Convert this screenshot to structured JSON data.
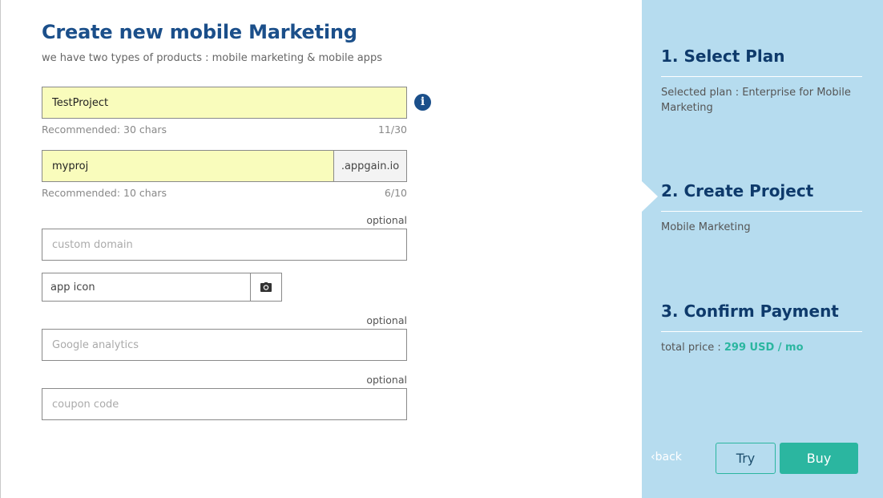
{
  "form": {
    "title": "Create new mobile Marketing",
    "subtitle": "we have two types of products : mobile marketing & mobile apps",
    "project_name": {
      "value": "TestProject",
      "hint": "Recommended: 30 chars",
      "count": "11/30"
    },
    "subdomain": {
      "value": "myproj",
      "suffix": ".appgain.io",
      "hint": "Recommended: 10 chars",
      "count": "6/10"
    },
    "custom_domain": {
      "optional_label": "optional",
      "placeholder": "custom domain"
    },
    "app_icon": {
      "label": "app icon"
    },
    "google_analytics": {
      "optional_label": "optional",
      "placeholder": "Google analytics"
    },
    "coupon": {
      "optional_label": "optional",
      "placeholder": "coupon code"
    }
  },
  "steps": {
    "plan": {
      "title": "1. Select Plan",
      "desc": "Selected plan : Enterprise for Mobile Marketing"
    },
    "project": {
      "title": "2. Create Project",
      "desc": "Mobile Marketing"
    },
    "payment": {
      "title": "3. Confirm Payment",
      "desc_prefix": "total price : ",
      "price": "299 USD / mo"
    }
  },
  "actions": {
    "back": "back",
    "try": "Try",
    "buy": "Buy"
  },
  "icons": {
    "info": "info-icon",
    "camera": "camera-icon",
    "back_chevron": "chevron-left-icon"
  },
  "colors": {
    "title": "#1b4f8a",
    "filled_input": "#f9fcbc",
    "sidebar": "#b6dcef",
    "accent": "#2bb6a0"
  }
}
